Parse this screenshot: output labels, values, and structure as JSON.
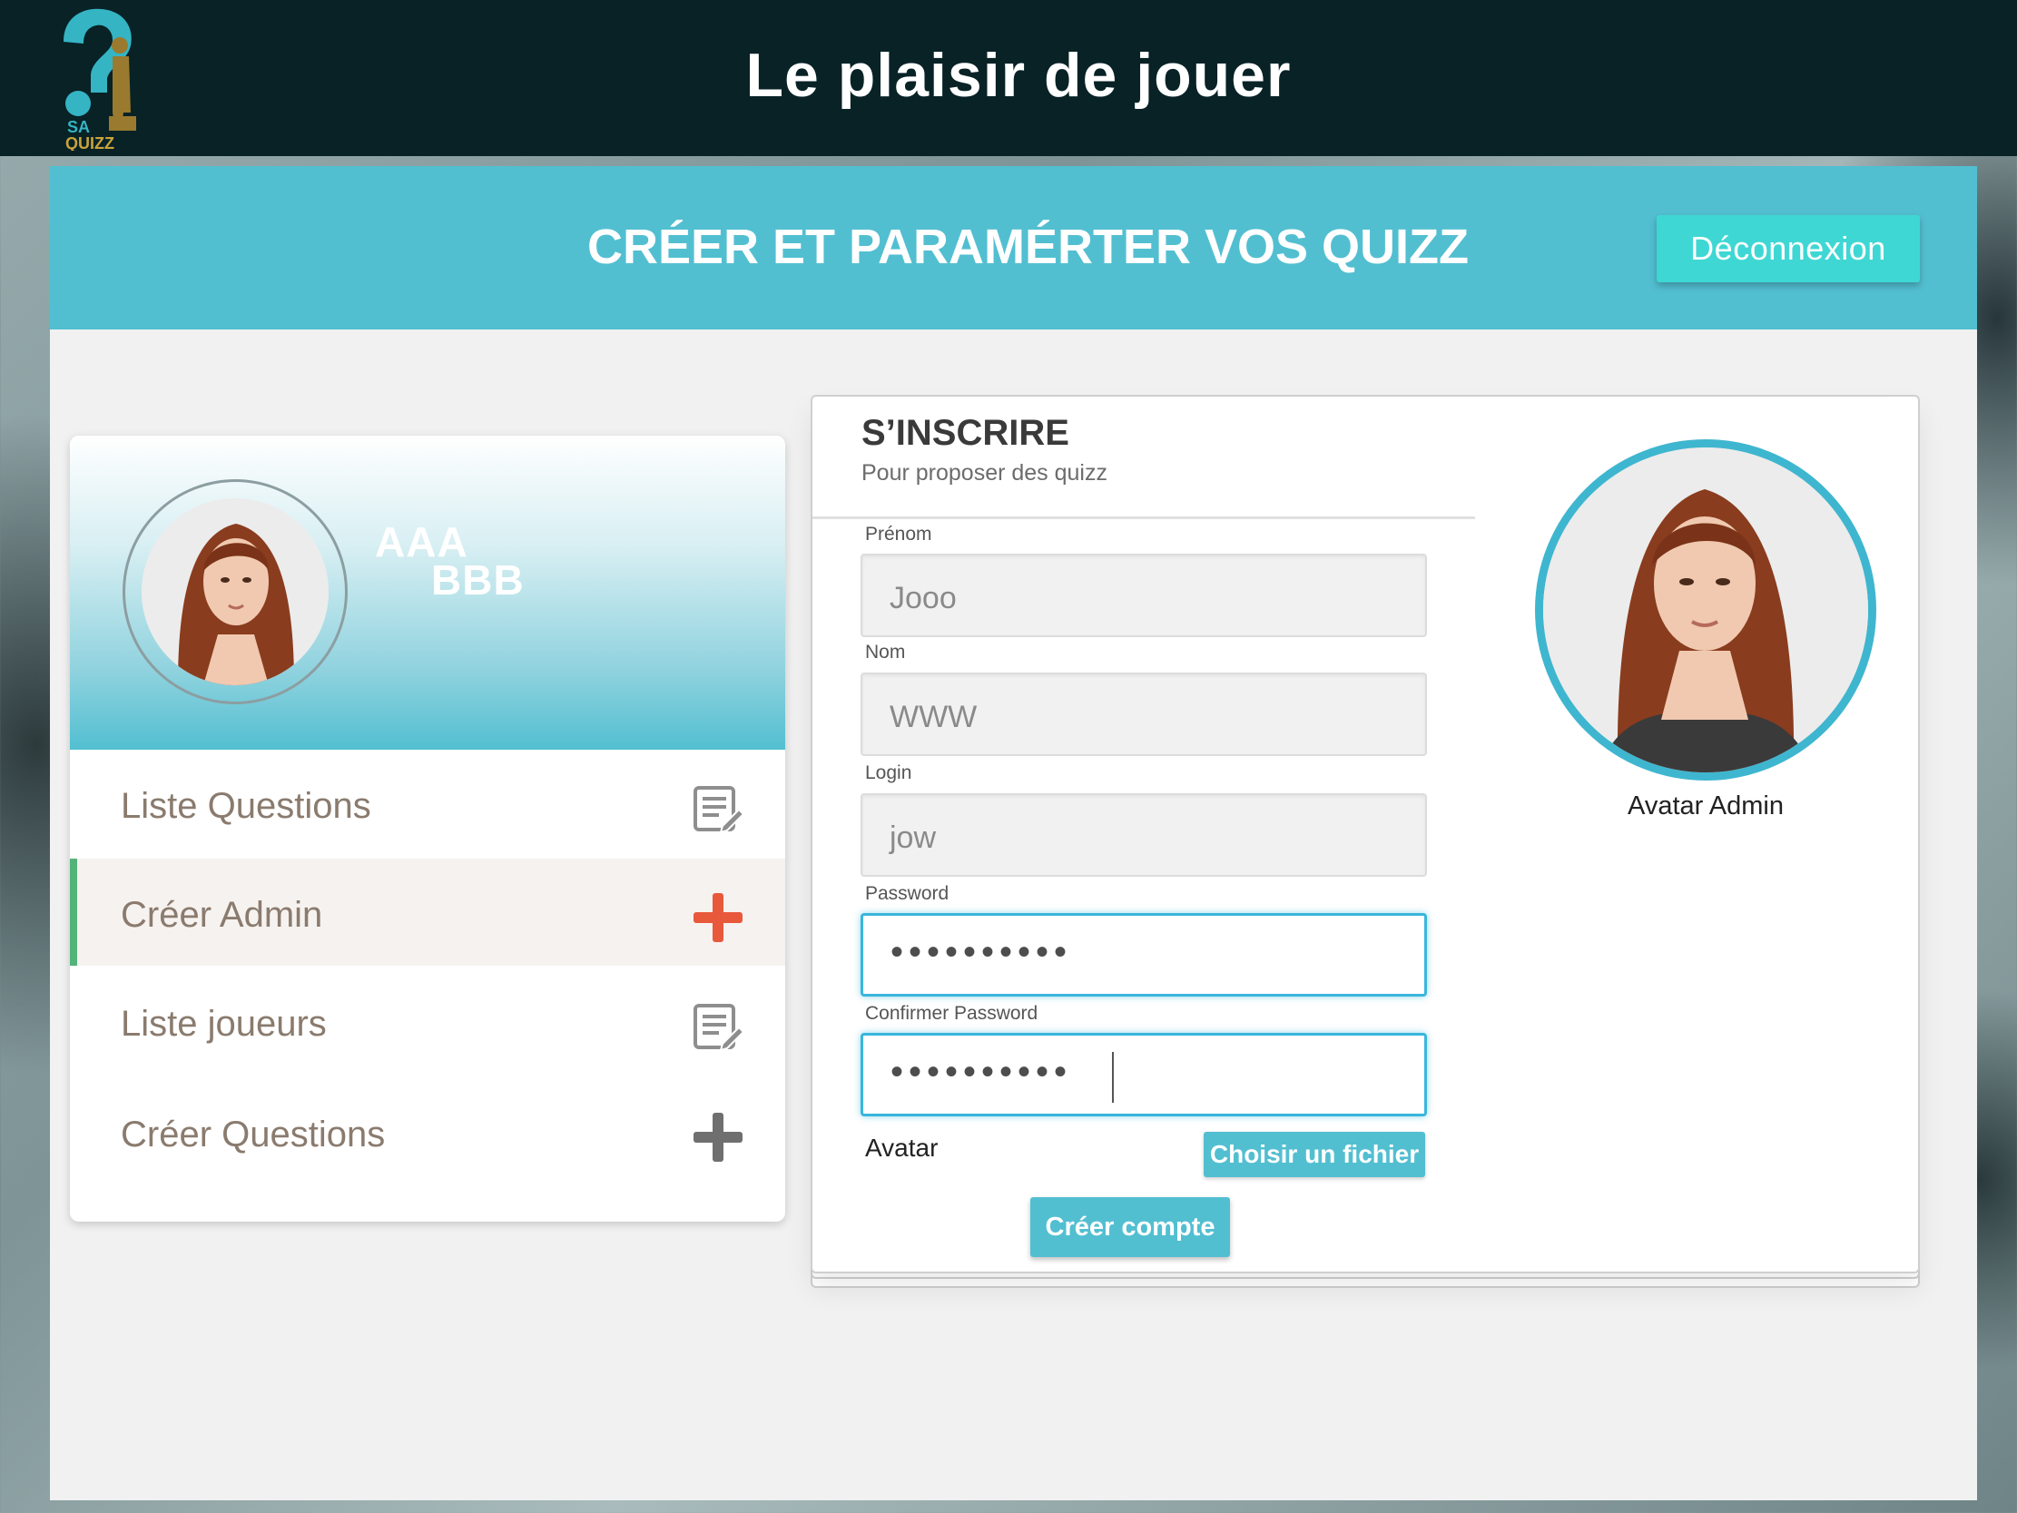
{
  "app": {
    "title": "Le plaisir de jouer",
    "logo_line1": "SA",
    "logo_line2": "QUIZZ"
  },
  "header": {
    "title": "CRÉER ET PARAMÉRTER VOS QUIZZ",
    "logout_label": "Déconnexion"
  },
  "profile": {
    "first_name": "AAA",
    "last_name": "BBB"
  },
  "menu": {
    "items": [
      {
        "label": "Liste Questions",
        "icon": "edit-list-icon",
        "active": false
      },
      {
        "label": "Créer Admin",
        "icon": "plus-icon",
        "active": true
      },
      {
        "label": "Liste joueurs",
        "icon": "edit-list-icon",
        "active": false
      },
      {
        "label": "Créer Questions",
        "icon": "plus-icon",
        "active": false
      }
    ]
  },
  "form": {
    "title": "S’INSCRIRE",
    "subtitle": "Pour proposer des quizz",
    "fields": [
      {
        "label": "Prénom",
        "value": "Jooo"
      },
      {
        "label": "Nom",
        "value": "WWW"
      },
      {
        "label": "Login",
        "value": "jow"
      },
      {
        "label": "Password",
        "value": "••••••••••"
      },
      {
        "label": "Confirmer Password",
        "value": "••••••••••"
      }
    ],
    "avatar_label": "Avatar",
    "file_button": "Choisir un fichier",
    "submit_button": "Créer compte",
    "avatar_caption": "Avatar Admin"
  },
  "colors": {
    "topbar": "#082226",
    "accent": "#52bfd1",
    "logout": "#3fd7d4",
    "active_border": "#54b37a",
    "plus_active": "#e8593c",
    "focus_border": "#39b6dc"
  }
}
